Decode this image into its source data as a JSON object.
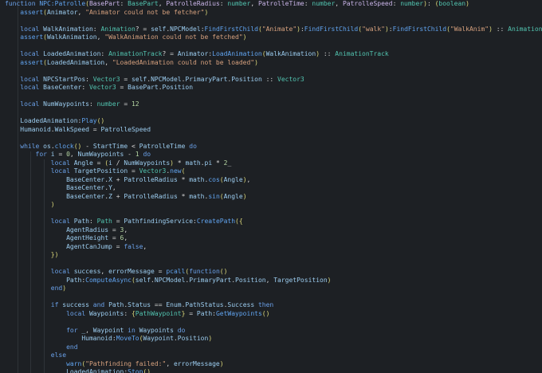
{
  "editor": {
    "lines": [
      [
        [
          "k",
          "function "
        ],
        [
          "f",
          "NPC:Patrolle"
        ],
        [
          "p",
          "("
        ],
        [
          "pm",
          "BasePart"
        ],
        [
          "w",
          ": "
        ],
        [
          "t",
          "BasePart"
        ],
        [
          "w",
          ", "
        ],
        [
          "pm",
          "PatrolleRadius"
        ],
        [
          "w",
          ": "
        ],
        [
          "t",
          "number"
        ],
        [
          "w",
          ", "
        ],
        [
          "pm",
          "PatrolleTime"
        ],
        [
          "w",
          ": "
        ],
        [
          "t",
          "number"
        ],
        [
          "w",
          ", "
        ],
        [
          "pm",
          "PatrolleSpeed"
        ],
        [
          "w",
          ": "
        ],
        [
          "t",
          "number"
        ],
        [
          "p",
          ")"
        ],
        [
          "w",
          ": "
        ],
        [
          "p",
          "("
        ],
        [
          "t",
          "boolean"
        ],
        [
          "p",
          ")"
        ]
      ],
      [
        [
          "w",
          "    "
        ],
        [
          "f",
          "assert"
        ],
        [
          "p",
          "("
        ],
        [
          "v",
          "Animator"
        ],
        [
          "w",
          ", "
        ],
        [
          "s",
          "\"Animator could not be fetcher\""
        ],
        [
          "p",
          ")"
        ]
      ],
      [
        [
          "w",
          ""
        ]
      ],
      [
        [
          "w",
          "    "
        ],
        [
          "k",
          "local "
        ],
        [
          "v",
          "WalkAnimation"
        ],
        [
          "w",
          ": "
        ],
        [
          "t",
          "Animation"
        ],
        [
          "w",
          "? = "
        ],
        [
          "v",
          "self"
        ],
        [
          "w",
          "."
        ],
        [
          "v",
          "NPCModel"
        ],
        [
          "w",
          ":"
        ],
        [
          "f",
          "FindFirstChild"
        ],
        [
          "p",
          "("
        ],
        [
          "s",
          "\"Animate\""
        ],
        [
          "p",
          ")"
        ],
        [
          "w",
          ":"
        ],
        [
          "f",
          "FindFirstChild"
        ],
        [
          "p",
          "("
        ],
        [
          "s",
          "\"walk\""
        ],
        [
          "p",
          ")"
        ],
        [
          "w",
          ":"
        ],
        [
          "f",
          "FindFirstChild"
        ],
        [
          "p",
          "("
        ],
        [
          "s",
          "\"WalkAnim\""
        ],
        [
          "p",
          ")"
        ],
        [
          "w",
          " :: "
        ],
        [
          "t",
          "Animation"
        ]
      ],
      [
        [
          "w",
          "    "
        ],
        [
          "f",
          "assert"
        ],
        [
          "p",
          "("
        ],
        [
          "v",
          "WalkAnimation"
        ],
        [
          "w",
          ", "
        ],
        [
          "s",
          "\"WalkAnimation could not be fetched\""
        ],
        [
          "p",
          ")"
        ]
      ],
      [
        [
          "w",
          ""
        ]
      ],
      [
        [
          "w",
          "    "
        ],
        [
          "k",
          "local "
        ],
        [
          "v",
          "LoadedAnimation"
        ],
        [
          "w",
          ": "
        ],
        [
          "t",
          "AnimationTrack"
        ],
        [
          "w",
          "? = "
        ],
        [
          "v",
          "Animator"
        ],
        [
          "w",
          ":"
        ],
        [
          "f",
          "LoadAnimation"
        ],
        [
          "p",
          "("
        ],
        [
          "v",
          "WalkAnimation"
        ],
        [
          "p",
          ")"
        ],
        [
          "w",
          " :: "
        ],
        [
          "t",
          "AnimationTrack"
        ]
      ],
      [
        [
          "w",
          "    "
        ],
        [
          "f",
          "assert"
        ],
        [
          "p",
          "("
        ],
        [
          "v",
          "LoadedAnimation"
        ],
        [
          "w",
          ", "
        ],
        [
          "s",
          "\"LoadedAnimation could not be loaded\""
        ],
        [
          "p",
          ")"
        ]
      ],
      [
        [
          "w",
          ""
        ]
      ],
      [
        [
          "w",
          "    "
        ],
        [
          "k",
          "local "
        ],
        [
          "v",
          "NPCStartPos"
        ],
        [
          "w",
          ": "
        ],
        [
          "t",
          "Vector3"
        ],
        [
          "w",
          " = "
        ],
        [
          "v",
          "self"
        ],
        [
          "w",
          "."
        ],
        [
          "v",
          "NPCModel"
        ],
        [
          "w",
          "."
        ],
        [
          "v",
          "PrimaryPart"
        ],
        [
          "w",
          "."
        ],
        [
          "v",
          "Position"
        ],
        [
          "w",
          " :: "
        ],
        [
          "t",
          "Vector3"
        ]
      ],
      [
        [
          "w",
          "    "
        ],
        [
          "k",
          "local "
        ],
        [
          "v",
          "BaseCenter"
        ],
        [
          "w",
          ": "
        ],
        [
          "t",
          "Vector3"
        ],
        [
          "w",
          " = "
        ],
        [
          "v",
          "BasePart"
        ],
        [
          "w",
          "."
        ],
        [
          "v",
          "Position"
        ]
      ],
      [
        [
          "w",
          ""
        ]
      ],
      [
        [
          "w",
          "    "
        ],
        [
          "k",
          "local "
        ],
        [
          "v",
          "NumWaypoints"
        ],
        [
          "w",
          ": "
        ],
        [
          "t",
          "number"
        ],
        [
          "w",
          " = "
        ],
        [
          "n",
          "12"
        ]
      ],
      [
        [
          "w",
          ""
        ]
      ],
      [
        [
          "w",
          "    "
        ],
        [
          "v",
          "LoadedAnimation"
        ],
        [
          "w",
          ":"
        ],
        [
          "f",
          "Play"
        ],
        [
          "p",
          "()"
        ]
      ],
      [
        [
          "w",
          "    "
        ],
        [
          "v",
          "Humanoid"
        ],
        [
          "w",
          "."
        ],
        [
          "v",
          "WalkSpeed"
        ],
        [
          "w",
          " = "
        ],
        [
          "v",
          "PatrolleSpeed"
        ]
      ],
      [
        [
          "w",
          ""
        ]
      ],
      [
        [
          "w",
          "    "
        ],
        [
          "k",
          "while "
        ],
        [
          "v",
          "os"
        ],
        [
          "w",
          "."
        ],
        [
          "f",
          "clock"
        ],
        [
          "p",
          "()"
        ],
        [
          "w",
          " - "
        ],
        [
          "v",
          "StartTime"
        ],
        [
          "w",
          " < "
        ],
        [
          "v",
          "PatrolleTime"
        ],
        [
          "k",
          " do"
        ]
      ],
      [
        [
          "w",
          "        "
        ],
        [
          "k",
          "for "
        ],
        [
          "v",
          "i"
        ],
        [
          "w",
          " = "
        ],
        [
          "n",
          "0"
        ],
        [
          "w",
          ", "
        ],
        [
          "v",
          "NumWaypoints"
        ],
        [
          "w",
          " - "
        ],
        [
          "n",
          "1"
        ],
        [
          "k",
          " do"
        ]
      ],
      [
        [
          "w",
          "            "
        ],
        [
          "k",
          "local "
        ],
        [
          "v",
          "Angle"
        ],
        [
          "w",
          " = "
        ],
        [
          "p",
          "("
        ],
        [
          "v",
          "i"
        ],
        [
          "w",
          " / "
        ],
        [
          "v",
          "NumWaypoints"
        ],
        [
          "p",
          ")"
        ],
        [
          "w",
          " * "
        ],
        [
          "v",
          "math"
        ],
        [
          "w",
          "."
        ],
        [
          "v",
          "pi"
        ],
        [
          "w",
          " * "
        ],
        [
          "n",
          "2"
        ],
        [
          "w",
          "_"
        ]
      ],
      [
        [
          "w",
          "            "
        ],
        [
          "k",
          "local "
        ],
        [
          "v",
          "TargetPosition"
        ],
        [
          "w",
          " = "
        ],
        [
          "t",
          "Vector3"
        ],
        [
          "w",
          "."
        ],
        [
          "f",
          "new"
        ],
        [
          "p",
          "("
        ]
      ],
      [
        [
          "w",
          "                "
        ],
        [
          "v",
          "BaseCenter"
        ],
        [
          "w",
          "."
        ],
        [
          "v",
          "X"
        ],
        [
          "w",
          " + "
        ],
        [
          "v",
          "PatrolleRadius"
        ],
        [
          "w",
          " * "
        ],
        [
          "v",
          "math"
        ],
        [
          "w",
          "."
        ],
        [
          "f",
          "cos"
        ],
        [
          "p",
          "("
        ],
        [
          "v",
          "Angle"
        ],
        [
          "p",
          ")"
        ],
        [
          "w",
          ","
        ]
      ],
      [
        [
          "w",
          "                "
        ],
        [
          "v",
          "BaseCenter"
        ],
        [
          "w",
          "."
        ],
        [
          "v",
          "Y"
        ],
        [
          "w",
          ","
        ]
      ],
      [
        [
          "w",
          "                "
        ],
        [
          "v",
          "BaseCenter"
        ],
        [
          "w",
          "."
        ],
        [
          "v",
          "Z"
        ],
        [
          "w",
          " + "
        ],
        [
          "v",
          "PatrolleRadius"
        ],
        [
          "w",
          " * "
        ],
        [
          "v",
          "math"
        ],
        [
          "w",
          "."
        ],
        [
          "f",
          "sin"
        ],
        [
          "p",
          "("
        ],
        [
          "v",
          "Angle"
        ],
        [
          "p",
          ")"
        ]
      ],
      [
        [
          "w",
          "            "
        ],
        [
          "p",
          ")"
        ]
      ],
      [
        [
          "w",
          ""
        ]
      ],
      [
        [
          "w",
          "            "
        ],
        [
          "k",
          "local "
        ],
        [
          "v",
          "Path"
        ],
        [
          "w",
          ": "
        ],
        [
          "t",
          "Path"
        ],
        [
          "w",
          " = "
        ],
        [
          "v",
          "PathfindingService"
        ],
        [
          "w",
          ":"
        ],
        [
          "f",
          "CreatePath"
        ],
        [
          "p",
          "({"
        ]
      ],
      [
        [
          "w",
          "                "
        ],
        [
          "v",
          "AgentRadius"
        ],
        [
          "w",
          " = "
        ],
        [
          "n",
          "3"
        ],
        [
          "w",
          ","
        ]
      ],
      [
        [
          "w",
          "                "
        ],
        [
          "v",
          "AgentHeight"
        ],
        [
          "w",
          " = "
        ],
        [
          "n",
          "6"
        ],
        [
          "w",
          ","
        ]
      ],
      [
        [
          "w",
          "                "
        ],
        [
          "v",
          "AgentCanJump"
        ],
        [
          "w",
          " = "
        ],
        [
          "k",
          "false"
        ],
        [
          "w",
          ","
        ]
      ],
      [
        [
          "w",
          "            "
        ],
        [
          "p",
          "})"
        ]
      ],
      [
        [
          "w",
          ""
        ]
      ],
      [
        [
          "w",
          "            "
        ],
        [
          "k",
          "local "
        ],
        [
          "v",
          "success"
        ],
        [
          "w",
          ", "
        ],
        [
          "v",
          "errorMessage"
        ],
        [
          "w",
          " = "
        ],
        [
          "f",
          "pcall"
        ],
        [
          "p",
          "("
        ],
        [
          "k",
          "function"
        ],
        [
          "p",
          "()"
        ]
      ],
      [
        [
          "w",
          "                "
        ],
        [
          "v",
          "Path"
        ],
        [
          "w",
          ":"
        ],
        [
          "f",
          "ComputeAsync"
        ],
        [
          "p",
          "("
        ],
        [
          "v",
          "self"
        ],
        [
          "w",
          "."
        ],
        [
          "v",
          "NPCModel"
        ],
        [
          "w",
          "."
        ],
        [
          "v",
          "PrimaryPart"
        ],
        [
          "w",
          "."
        ],
        [
          "v",
          "Position"
        ],
        [
          "w",
          ", "
        ],
        [
          "v",
          "TargetPosition"
        ],
        [
          "p",
          ")"
        ]
      ],
      [
        [
          "w",
          "            "
        ],
        [
          "k",
          "end"
        ],
        [
          "p",
          ")"
        ]
      ],
      [
        [
          "w",
          ""
        ]
      ],
      [
        [
          "w",
          "            "
        ],
        [
          "k",
          "if "
        ],
        [
          "v",
          "success"
        ],
        [
          "k",
          " and "
        ],
        [
          "v",
          "Path"
        ],
        [
          "w",
          "."
        ],
        [
          "v",
          "Status"
        ],
        [
          "w",
          " == "
        ],
        [
          "v",
          "Enum"
        ],
        [
          "w",
          "."
        ],
        [
          "v",
          "PathStatus"
        ],
        [
          "w",
          "."
        ],
        [
          "v",
          "Success"
        ],
        [
          "k",
          " then"
        ]
      ],
      [
        [
          "w",
          "                "
        ],
        [
          "k",
          "local "
        ],
        [
          "v",
          "Waypoints"
        ],
        [
          "w",
          ": "
        ],
        [
          "p",
          "{"
        ],
        [
          "t",
          "PathWaypoint"
        ],
        [
          "p",
          "}"
        ],
        [
          "w",
          " = "
        ],
        [
          "v",
          "Path"
        ],
        [
          "w",
          ":"
        ],
        [
          "f",
          "GetWaypoints"
        ],
        [
          "p",
          "()"
        ]
      ],
      [
        [
          "w",
          ""
        ]
      ],
      [
        [
          "w",
          "                "
        ],
        [
          "k",
          "for "
        ],
        [
          "v",
          "_"
        ],
        [
          "w",
          ", "
        ],
        [
          "v",
          "Waypoint"
        ],
        [
          "k",
          " in "
        ],
        [
          "v",
          "Waypoints"
        ],
        [
          "k",
          " do"
        ]
      ],
      [
        [
          "w",
          "                    "
        ],
        [
          "v",
          "Humanoid"
        ],
        [
          "w",
          ":"
        ],
        [
          "f",
          "MoveTo"
        ],
        [
          "p",
          "("
        ],
        [
          "v",
          "Waypoint"
        ],
        [
          "w",
          "."
        ],
        [
          "v",
          "Position"
        ],
        [
          "p",
          ")"
        ]
      ],
      [
        [
          "w",
          "                "
        ],
        [
          "k",
          "end"
        ]
      ],
      [
        [
          "w",
          "            "
        ],
        [
          "k",
          "else"
        ]
      ],
      [
        [
          "w",
          "                "
        ],
        [
          "f",
          "warn"
        ],
        [
          "p",
          "("
        ],
        [
          "s",
          "\"Pathfinding failed:\""
        ],
        [
          "w",
          ", "
        ],
        [
          "v",
          "errorMessage"
        ],
        [
          "p",
          ")"
        ]
      ],
      [
        [
          "w",
          "                "
        ],
        [
          "v",
          "LoadedAnimation"
        ],
        [
          "w",
          ":"
        ],
        [
          "f",
          "Stop"
        ],
        [
          "p",
          "()"
        ]
      ]
    ]
  }
}
